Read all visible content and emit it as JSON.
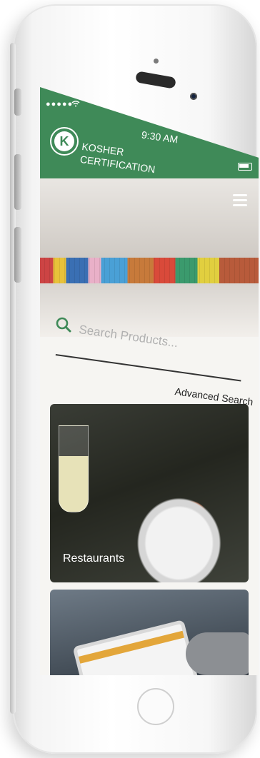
{
  "status": {
    "dots": "●●●●●",
    "time": "9:30 AM"
  },
  "brand": {
    "logo_letter": "K",
    "line1": "KOSHER",
    "line2": "CERTIFICATION",
    "accent": "#3f8a58"
  },
  "search": {
    "placeholder": "Search Products...",
    "advanced_label": "Advanced Search"
  },
  "cards": [
    {
      "label": "Restaurants"
    },
    {
      "label": ""
    }
  ]
}
